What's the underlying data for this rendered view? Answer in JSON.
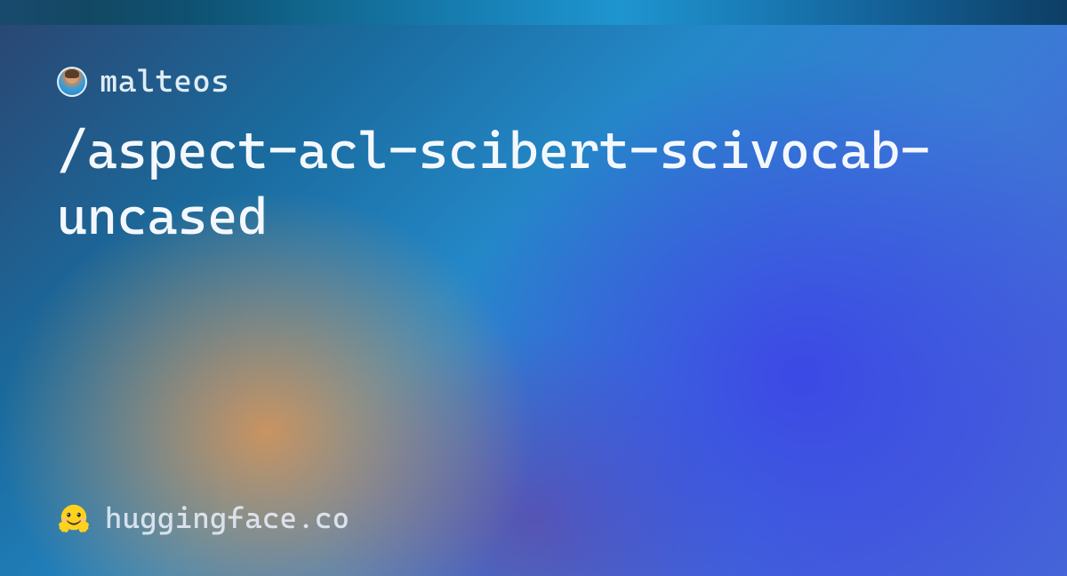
{
  "user": {
    "name": "malteos"
  },
  "model": {
    "path": "/aspect-acl-scibert-scivocab-uncased"
  },
  "footer": {
    "domain": "huggingface.co"
  }
}
